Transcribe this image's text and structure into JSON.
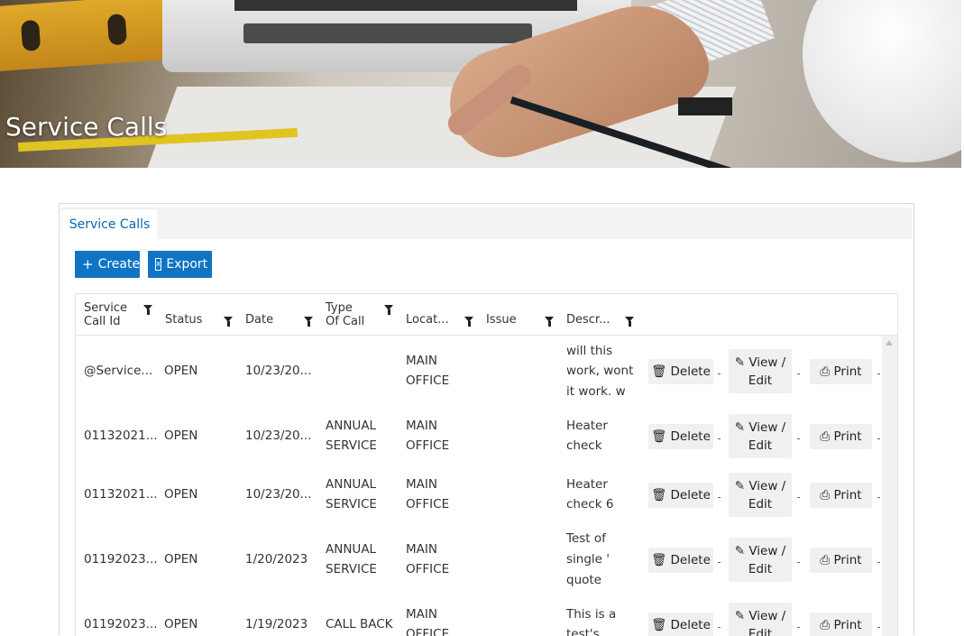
{
  "banner": {
    "title": "Service Calls"
  },
  "tabs": [
    {
      "label": "Service Calls",
      "active": true
    }
  ],
  "toolbar": {
    "create_label": "Create",
    "create_glyph": "+",
    "export_label": "Export",
    "export_glyph": "x"
  },
  "grid": {
    "columns": [
      {
        "label": "Service Call Id",
        "filter": true
      },
      {
        "label": "Status",
        "filter": true
      },
      {
        "label": "Date",
        "filter": true
      },
      {
        "label": "Type Of Call",
        "filter": true
      },
      {
        "label": "Locat...",
        "filter": true
      },
      {
        "label": "Issue",
        "filter": true
      },
      {
        "label": "Descr...",
        "filter": true
      }
    ],
    "header_lines": {
      "col0a": "Service",
      "col0b": "Call Id",
      "col3a": "Type",
      "col3b": "Of Call"
    },
    "actions": {
      "delete": "Delete",
      "view_line1": "View /",
      "view_line2": "Edit",
      "print": "Print"
    },
    "rows": [
      {
        "id": "@Service...",
        "status": "OPEN",
        "date": "10/23/20...",
        "type1": "",
        "type2": "",
        "loc1": "MAIN",
        "loc2": "OFFICE",
        "issue": "",
        "desc1": "will this",
        "desc2": "work, wont",
        "desc3": "it work. w"
      },
      {
        "id": "01132021...",
        "status": "OPEN",
        "date": "10/23/20...",
        "type1": "ANNUAL",
        "type2": "SERVICE",
        "loc1": "MAIN",
        "loc2": "OFFICE",
        "issue": "",
        "desc1": "Heater",
        "desc2": "check",
        "desc3": ""
      },
      {
        "id": "01132021...",
        "status": "OPEN",
        "date": "10/23/20...",
        "type1": "ANNUAL",
        "type2": "SERVICE",
        "loc1": "MAIN",
        "loc2": "OFFICE",
        "issue": "",
        "desc1": "Heater",
        "desc2": "check 6",
        "desc3": ""
      },
      {
        "id": "01192023...",
        "status": "OPEN",
        "date": "1/20/2023",
        "type1": "ANNUAL",
        "type2": "SERVICE",
        "loc1": "MAIN",
        "loc2": "OFFICE",
        "issue": "",
        "desc1": "Test of",
        "desc2": "single '",
        "desc3": "quote"
      },
      {
        "id": "01192023...",
        "status": "OPEN",
        "date": "1/19/2023",
        "type1": "CALL BACK",
        "type2": "",
        "loc1": "MAIN",
        "loc2": "OFFICE",
        "issue": "",
        "desc1": "This is a",
        "desc2": "test's",
        "desc3": ""
      }
    ]
  },
  "icons": {
    "delete": "trash-icon",
    "view": "pencil-icon",
    "print": "printer-icon",
    "filter": "funnel-icon",
    "scroll_up": "scroll-up-arrow-icon"
  },
  "colors": {
    "accent": "#0f74c4",
    "tab_text": "#0b67b2",
    "action_bg": "#f0f0f0"
  }
}
